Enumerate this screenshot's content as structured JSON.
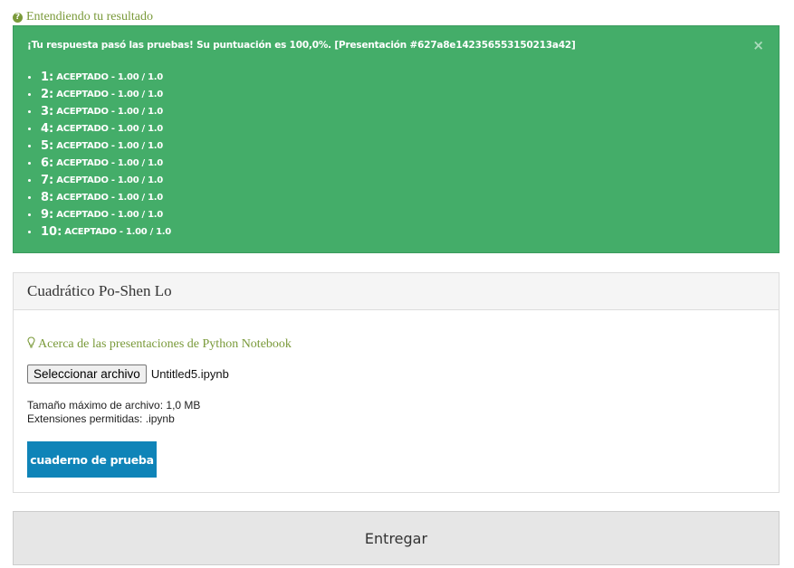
{
  "help": {
    "label": "Entendiendo tu resultado",
    "icon": "question-circle-icon"
  },
  "alert": {
    "message": "¡Tu respuesta pasó las pruebas! Su puntuación es 100,0%. [Presentación #627a8e142356553150213a42]",
    "close_glyph": "×",
    "results": [
      {
        "num": "1:",
        "text": "ACEPTADO - 1.00 / 1.0"
      },
      {
        "num": "2:",
        "text": "ACEPTADO - 1.00 / 1.0"
      },
      {
        "num": "3:",
        "text": "ACEPTADO - 1.00 / 1.0"
      },
      {
        "num": "4:",
        "text": "ACEPTADO - 1.00 / 1.0"
      },
      {
        "num": "5:",
        "text": "ACEPTADO - 1.00 / 1.0"
      },
      {
        "num": "6:",
        "text": "ACEPTADO - 1.00 / 1.0"
      },
      {
        "num": "7:",
        "text": "ACEPTADO - 1.00 / 1.0"
      },
      {
        "num": "8:",
        "text": "ACEPTADO - 1.00 / 1.0"
      },
      {
        "num": "9:",
        "text": "ACEPTADO - 1.00 / 1.0"
      },
      {
        "num": "10:",
        "text": "ACEPTADO - 1.00 / 1.0"
      }
    ]
  },
  "panel": {
    "title": "Cuadrático Po-Shen Lo",
    "notebook_link": "Acerca de las presentaciones de Python Notebook",
    "notebook_icon": "lightbulb-icon",
    "file_button": "Seleccionar archivo",
    "file_name": "Untitled5.ipynb",
    "max_size": "Tamaño máximo de archivo: 1,0 MB",
    "extensions": "Extensiones permitidas: .ipynb",
    "test_button": "cuaderno de prueba"
  },
  "submit_label": "Entregar",
  "colors": {
    "success": "#44ad69",
    "link": "#7a9a3a",
    "primary": "#0f84b8"
  }
}
